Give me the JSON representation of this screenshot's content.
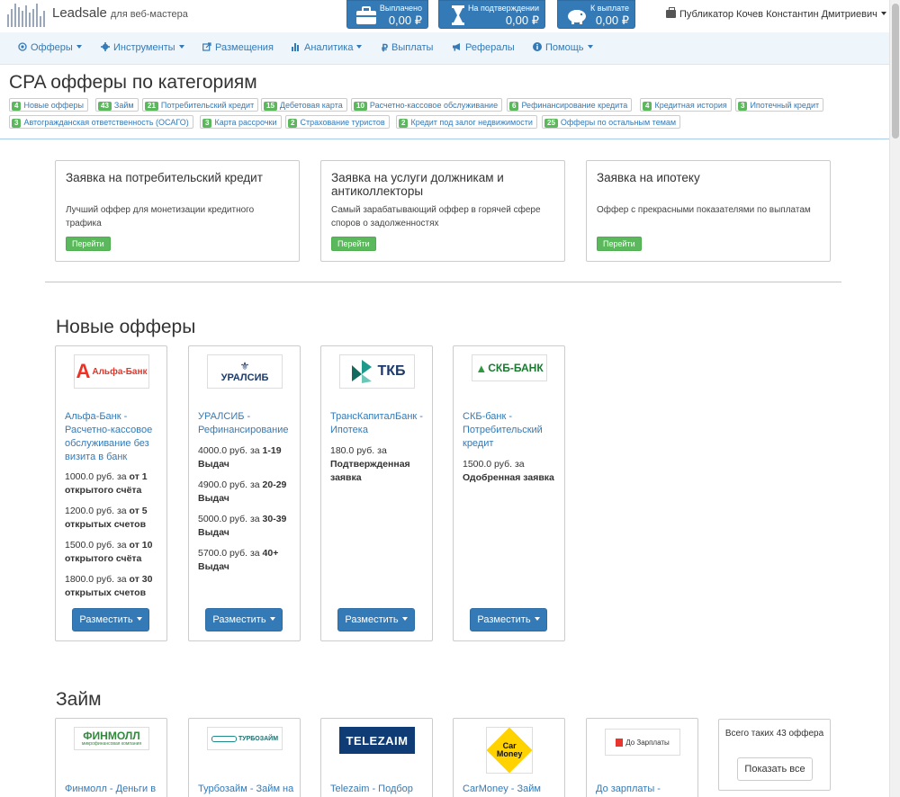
{
  "brand": {
    "name": "Leadsale",
    "subtitle": "для веб-мастера"
  },
  "balances": [
    {
      "label": "Выплачено",
      "value": "0,00 ₽",
      "icon": "briefcase-icon"
    },
    {
      "label": "На подтверждении",
      "value": "0,00 ₽",
      "icon": "hourglass-icon"
    },
    {
      "label": "К выплате",
      "value": "0,00 ₽",
      "icon": "piggy-bank-icon"
    }
  ],
  "user": {
    "name": "Публикатор Кочев Константин Дмитриевич"
  },
  "nav": [
    {
      "label": "Офферы",
      "icon": "target-icon",
      "dropdown": true
    },
    {
      "label": "Инструменты",
      "icon": "gear-icon",
      "dropdown": true
    },
    {
      "label": "Размещения",
      "icon": "share-icon",
      "dropdown": false
    },
    {
      "label": "Аналитика",
      "icon": "bar-chart-icon",
      "dropdown": true
    },
    {
      "label": "Выплаты",
      "icon": "ruble-icon",
      "dropdown": false
    },
    {
      "label": "Рефералы",
      "icon": "megaphone-icon",
      "dropdown": false
    },
    {
      "label": "Помощь",
      "icon": "info-icon",
      "dropdown": true
    }
  ],
  "categories_title": "CPA офферы по категориям",
  "tags": [
    {
      "count": "4",
      "label": "Новые офферы"
    },
    {
      "count": "43",
      "label": "Займ"
    },
    {
      "count": "21",
      "label": "Потребительский кредит"
    },
    {
      "count": "15",
      "label": "Дебетовая карта"
    },
    {
      "count": "10",
      "label": "Расчетно-кассовое обслуживание"
    },
    {
      "count": "6",
      "label": "Рефинансирование кредита"
    },
    {
      "count": "4",
      "label": "Кредитная история"
    },
    {
      "count": "3",
      "label": "Ипотечный кредит"
    },
    {
      "count": "3",
      "label": "Автогражданская ответственность (ОСАГО)"
    },
    {
      "count": "3",
      "label": "Карта рассрочки"
    },
    {
      "count": "2",
      "label": "Страхование туристов"
    },
    {
      "count": "2",
      "label": "Кредит под залог недвижимости"
    },
    {
      "count": "25",
      "label": "Офферы по остальным темам"
    }
  ],
  "promos": [
    {
      "title": "Заявка на потребительский кредит",
      "desc": "Лучший оффер для монетизации кредитного трафика",
      "button": "Перейти"
    },
    {
      "title": "Заявка на услуги должникам и антиколлекторы",
      "desc": "Самый зарабатывающий оффер в горячей сфере споров о задолженностях",
      "button": "Перейти"
    },
    {
      "title": "Заявка на ипотеку",
      "desc": "Оффер с прекрасными показателями по выплатам",
      "button": "Перейти"
    }
  ],
  "new_offers": {
    "title": "Новые офферы",
    "place_label": "Разместить",
    "cards": [
      {
        "logo": "Альфа-Банк",
        "title": "Альфа-Банк - Расчетно-кассовое обслуживание без визита в банк",
        "rates": [
          {
            "pre": "1000.0 руб. за ",
            "bold": "от 1 открытого счёта"
          },
          {
            "pre": "1200.0 руб. за ",
            "bold": "от 5 открытых счетов"
          },
          {
            "pre": "1500.0 руб. за ",
            "bold": "от 10 открытого счёта"
          },
          {
            "pre": "1800.0 руб. за ",
            "bold": "от 30 открытых счетов"
          }
        ]
      },
      {
        "logo": "УРАЛСИБ",
        "title": "УРАЛСИБ - Рефинансирование",
        "rates": [
          {
            "pre": "4000.0 руб. за ",
            "bold": "1-19 Выдач"
          },
          {
            "pre": "4900.0 руб. за ",
            "bold": "20-29 Выдач"
          },
          {
            "pre": "5000.0 руб. за ",
            "bold": "30-39 Выдач"
          },
          {
            "pre": "5700.0 руб. за ",
            "bold": "40+ Выдач"
          }
        ]
      },
      {
        "logo": "ТКБ",
        "title": "ТрансКапиталБанк - Ипотека",
        "rates": [
          {
            "pre": "180.0 руб. за ",
            "bold": "Подтвержденная заявка"
          }
        ]
      },
      {
        "logo": "СКБ-БАНК",
        "title": "СКБ-банк - Потребительский кредит",
        "rates": [
          {
            "pre": "1500.0 руб. за ",
            "bold": "Одобренная заявка"
          }
        ]
      }
    ]
  },
  "loans": {
    "title": "Займ",
    "cards": [
      {
        "logo": "ФИНМОЛЛ",
        "logo_sub": "микрофинансовая компания",
        "title": "Финмолл - Деньги в"
      },
      {
        "logo": "ТУРБОЗАЙМ",
        "title": "Турбозайм - Займ на"
      },
      {
        "logo": "TELEZAIM",
        "title": "Telezaim - Подбор"
      },
      {
        "logo_line1": "Car",
        "logo_line2": "Money",
        "title": "CarMoney - Займ"
      },
      {
        "logo": "До Зарплаты",
        "title": "До зарплаты -"
      }
    ],
    "more_text": "Всего таких 43 оффера",
    "more_button": "Показать все"
  }
}
